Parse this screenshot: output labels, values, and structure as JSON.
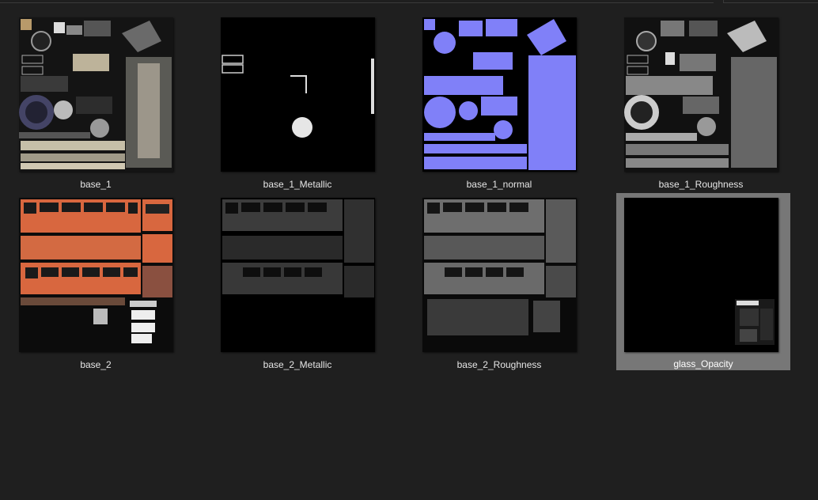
{
  "files": [
    {
      "name": "base_1",
      "map": "base-color",
      "selected": false
    },
    {
      "name": "base_1_Metallic",
      "map": "metallic",
      "selected": false
    },
    {
      "name": "base_1_normal",
      "map": "normal",
      "selected": false
    },
    {
      "name": "base_1_Roughness",
      "map": "roughness",
      "selected": false
    },
    {
      "name": "base_2",
      "map": "base-color",
      "selected": false
    },
    {
      "name": "base_2_Metallic",
      "map": "metallic",
      "selected": false
    },
    {
      "name": "base_2_Roughness",
      "map": "roughness",
      "selected": false
    },
    {
      "name": "glass_Opacity",
      "map": "opacity",
      "selected": true
    }
  ],
  "colors": {
    "background": "#1f1f1f",
    "selection": "#777777",
    "normal_map": "#8080f8",
    "bus_orange": "#d8673f"
  }
}
